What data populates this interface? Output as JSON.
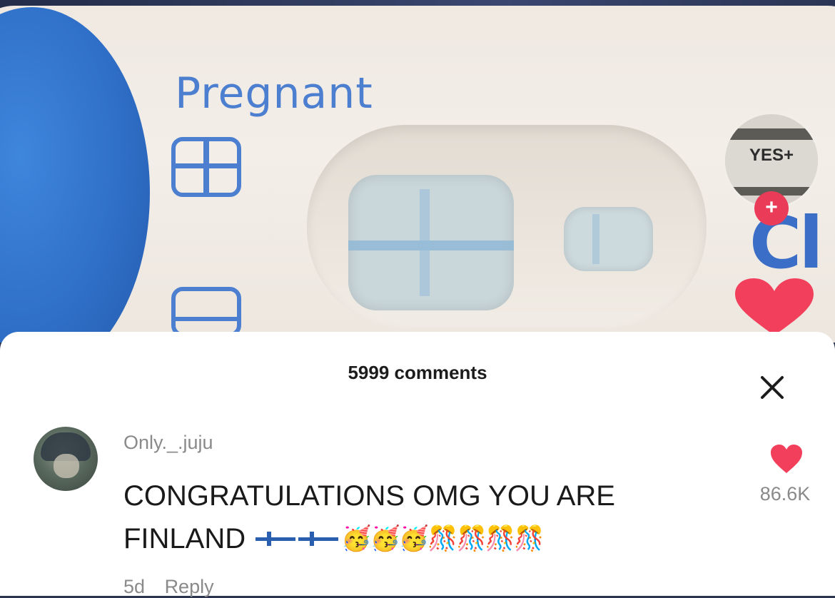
{
  "video": {
    "test_label": "Pregnant",
    "profile_badge": "YES+",
    "follow_symbol": "+",
    "brand_partial": "Cl"
  },
  "comments_sheet": {
    "count_label": "5999 comments",
    "close_symbol": "×",
    "comment": {
      "username": "Only._.juju",
      "text_line1": "CONGRATULATIONS OMG YOU ARE",
      "text_line2": "FINLAND",
      "emojis": "🥳🥳🥳🎊🎊🎊🎊",
      "time": "5d",
      "reply_label": "Reply",
      "like_count": "86.6K"
    }
  },
  "colors": {
    "accent_red": "#ea3b59",
    "test_blue": "#4d7fd0",
    "text_primary": "#1a1a1a",
    "text_secondary": "#8a8a8a"
  },
  "icons": [
    "close-icon",
    "heart-icon",
    "follow-plus-icon",
    "finland-flag-icon"
  ]
}
